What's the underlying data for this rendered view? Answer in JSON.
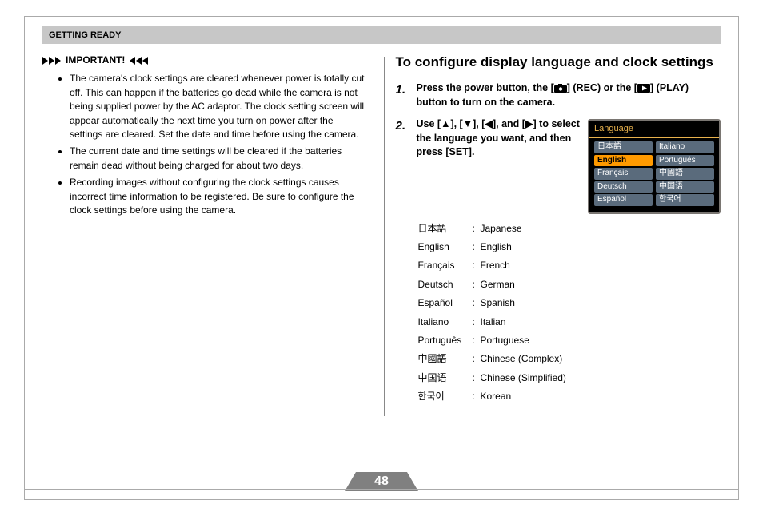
{
  "header": {
    "title": "GETTING READY"
  },
  "left": {
    "important_label": "IMPORTANT!",
    "bullets": [
      "The camera's clock settings are cleared whenever power is totally cut off. This can happen if the batteries go dead while the camera is not being supplied power by the AC adaptor. The clock setting screen will appear automatically the next time you turn on power after the settings are cleared. Set the date and time before using the camera.",
      "The current date and time settings will be cleared if the batteries remain dead without being charged for about two days.",
      "Recording images without configuring the clock settings causes incorrect time information to be registered. Be sure to configure the clock settings before using the camera."
    ]
  },
  "right": {
    "section_title": "To configure display language and clock settings",
    "step1_num": "1.",
    "step1_a": "Press the power button, the [",
    "step1_b": "] (REC) or the [",
    "step1_c": "] (PLAY) button to turn on the camera.",
    "step2_num": "2.",
    "step2": "Use [▲], [▼], [◀], and [▶] to select the language you want, and then press [SET].",
    "language_list": [
      {
        "native": "日本語",
        "trans": "Japanese"
      },
      {
        "native": "English",
        "trans": "English"
      },
      {
        "native": "Français",
        "trans": "French"
      },
      {
        "native": "Deutsch",
        "trans": "German"
      },
      {
        "native": "Español",
        "trans": "Spanish"
      },
      {
        "native": "Italiano",
        "trans": "Italian"
      },
      {
        "native": "Português",
        "trans": "Portuguese"
      },
      {
        "native": "中國語",
        "trans": "Chinese (Complex)"
      },
      {
        "native": "中国语",
        "trans": "Chinese (Simplified)"
      },
      {
        "native": "한국어",
        "trans": "Korean"
      }
    ],
    "menu": {
      "heading": "Language",
      "left_col": [
        "日本語",
        "English",
        "Français",
        "Deutsch",
        "Español"
      ],
      "right_col": [
        "Italiano",
        "Português",
        "中國語",
        "中国语",
        "한국어"
      ],
      "selected": "English"
    }
  },
  "page_number": "48"
}
